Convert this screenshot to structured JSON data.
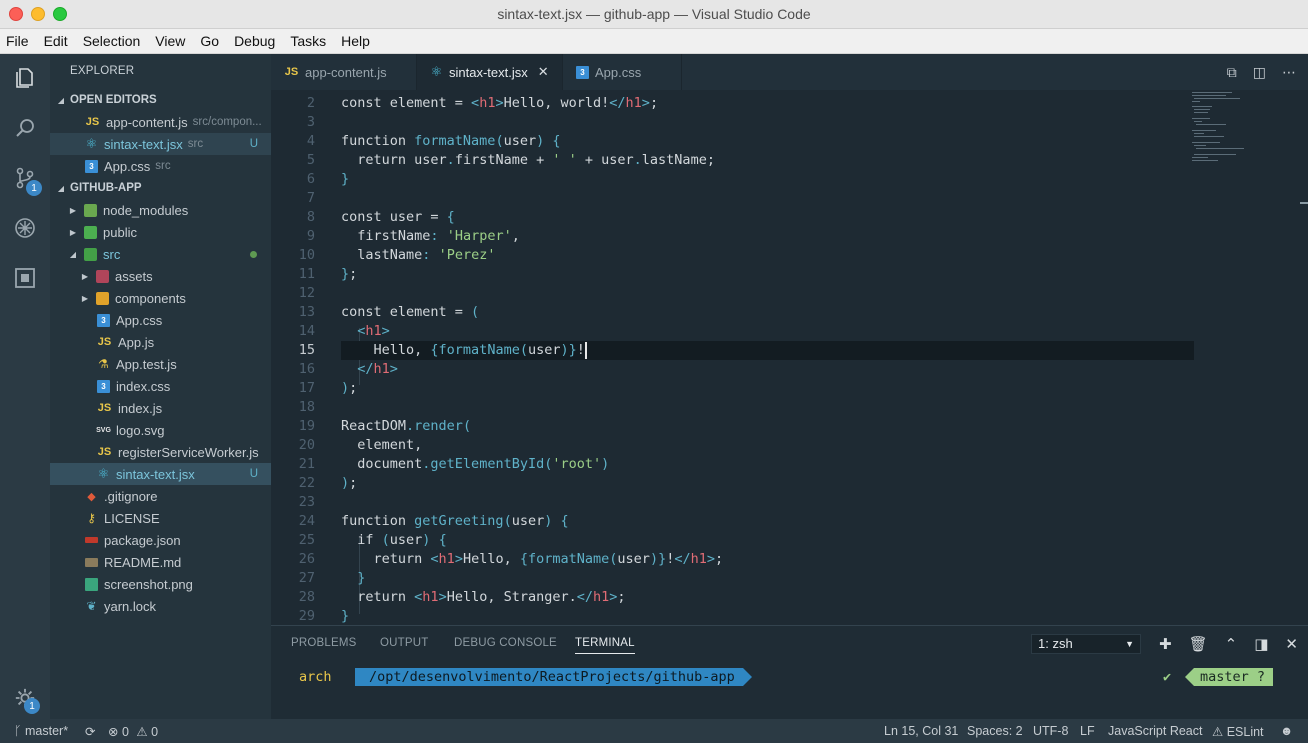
{
  "window": {
    "title": "sintax-text.jsx — github-app — Visual Studio Code"
  },
  "menu": [
    "File",
    "Edit",
    "Selection",
    "View",
    "Go",
    "Debug",
    "Tasks",
    "Help"
  ],
  "activity": {
    "scm_badge": "1",
    "settings_badge": "1"
  },
  "sidebar": {
    "title": "EXPLORER",
    "open_editors_label": "OPEN EDITORS",
    "open_editors": [
      {
        "name": "app-content.js",
        "path": "src/compon...",
        "icon": "JS"
      },
      {
        "name": "sintax-text.jsx",
        "path": "src",
        "status": "U"
      },
      {
        "name": "App.css",
        "path": "src"
      }
    ],
    "project_label": "GITHUB-APP",
    "tree": [
      {
        "name": "node_modules"
      },
      {
        "name": "public"
      },
      {
        "name": "src"
      },
      {
        "name": "assets"
      },
      {
        "name": "components"
      },
      {
        "name": "App.css"
      },
      {
        "name": "App.js",
        "icon": "JS"
      },
      {
        "name": "App.test.js"
      },
      {
        "name": "index.css"
      },
      {
        "name": "index.js",
        "icon": "JS"
      },
      {
        "name": "logo.svg",
        "icon": "SVG"
      },
      {
        "name": "registerServiceWorker.js",
        "icon": "JS"
      },
      {
        "name": "sintax-text.jsx",
        "status": "U"
      },
      {
        "name": ".gitignore"
      },
      {
        "name": "LICENSE"
      },
      {
        "name": "package.json"
      },
      {
        "name": "README.md"
      },
      {
        "name": "screenshot.png"
      },
      {
        "name": "yarn.lock"
      }
    ]
  },
  "tabs": [
    {
      "label": "app-content.js",
      "icon": "JS"
    },
    {
      "label": "sintax-text.jsx"
    },
    {
      "label": "App.css"
    }
  ],
  "editor": {
    "line_numbers": [
      "2",
      "3",
      "4",
      "5",
      "6",
      "7",
      "8",
      "9",
      "10",
      "11",
      "12",
      "13",
      "14",
      "15",
      "16",
      "17",
      "18",
      "19",
      "20",
      "21",
      "22",
      "23",
      "24",
      "25",
      "26",
      "27",
      "28",
      "29"
    ]
  },
  "panel": {
    "tabs": [
      "PROBLEMS",
      "OUTPUT",
      "DEBUG CONSOLE",
      "TERMINAL"
    ],
    "terminal_select": "1: zsh",
    "prompt_user": "arch",
    "prompt_path": "/opt/desenvolvimento/ReactProjects/github-app",
    "prompt_check": "✔",
    "prompt_branch": "master ?"
  },
  "status": {
    "branch": "master*",
    "errors": "0",
    "warnings": "0",
    "position": "Ln 15, Col 31",
    "spaces": "Spaces: 2",
    "encoding": "UTF-8",
    "eol": "LF",
    "language": "JavaScript React",
    "linter": "ESLint"
  }
}
